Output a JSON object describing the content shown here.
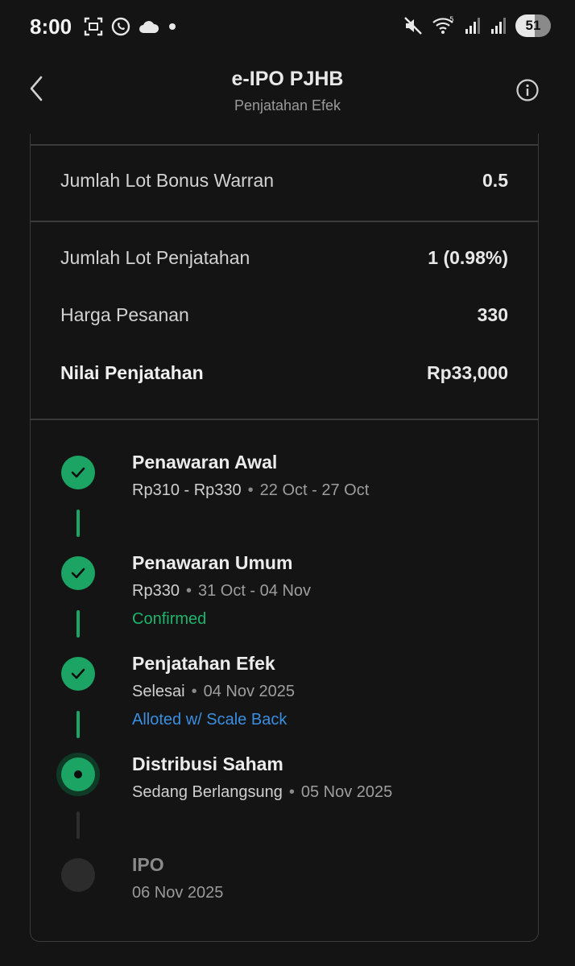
{
  "status_bar": {
    "time": "8:00",
    "battery": "51",
    "left_icons": [
      "screenshot-icon",
      "whatsapp-icon",
      "cloud-icon",
      "dot-icon"
    ],
    "right_icons": [
      "mute-icon",
      "wifi-icon",
      "signal-icon",
      "signal-icon"
    ]
  },
  "header": {
    "title": "e-IPO PJHB",
    "subtitle": "Penjatahan Efek"
  },
  "details": {
    "bonus_warran_label": "Jumlah Lot Bonus Warran",
    "bonus_warran_value": "0.5",
    "lot_penjatahan_label": "Jumlah Lot Penjatahan",
    "lot_penjatahan_value": "1 (0.98%)",
    "harga_pesanan_label": "Harga Pesanan",
    "harga_pesanan_value": "330",
    "nilai_penjatahan_label": "Nilai Penjatahan",
    "nilai_penjatahan_value": "Rp33,000"
  },
  "timeline": [
    {
      "title": "Penawaran Awal",
      "detail": "Rp310 - Rp330",
      "date": "22 Oct - 27 Oct",
      "status": "",
      "state": "done"
    },
    {
      "title": "Penawaran Umum",
      "detail": "Rp330",
      "date": "31 Oct - 04 Nov",
      "status": "Confirmed",
      "status_color": "#1db46c",
      "state": "done"
    },
    {
      "title": "Penjatahan Efek",
      "detail": "Selesai",
      "date": "04 Nov 2025",
      "status": "Alloted w/ Scale Back",
      "status_color": "#3a8ee0",
      "state": "done"
    },
    {
      "title": "Distribusi Saham",
      "detail": "Sedang Berlangsung",
      "date": "05 Nov 2025",
      "status": "",
      "state": "current"
    },
    {
      "title": "IPO",
      "detail": "06 Nov 2025",
      "date": "",
      "status": "",
      "state": "pending"
    }
  ],
  "colors": {
    "accent_green": "#1ba463",
    "confirmed_text": "#1db46c",
    "alloted_text": "#3a8ee0",
    "background": "#141414"
  }
}
